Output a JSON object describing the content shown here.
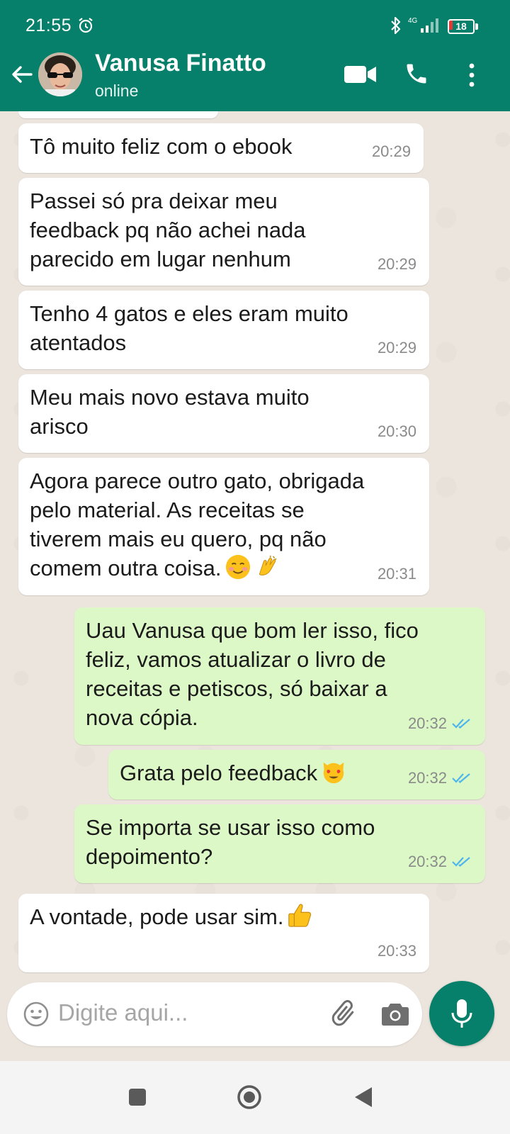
{
  "status_bar": {
    "time": "21:55",
    "network": "4G",
    "battery": "18",
    "icons": [
      "alarm-icon",
      "bluetooth-icon",
      "signal-icon",
      "battery-icon"
    ]
  },
  "header": {
    "contact_name": "Vanusa Finatto",
    "status": "online",
    "icons": [
      "back-arrow-icon",
      "video-call-icon",
      "phone-icon",
      "menu-icon"
    ]
  },
  "messages": [
    {
      "direction": "in",
      "text": "Tô muito feliz com o ebook",
      "time": "20:29"
    },
    {
      "direction": "in",
      "text": "Passei só pra deixar meu\nfeedback pq não achei nada\nparecido em lugar nenhum",
      "time": "20:29"
    },
    {
      "direction": "in",
      "text": "Tenho 4 gatos e eles eram muito\natentados",
      "time": "20:29"
    },
    {
      "direction": "in",
      "text": "Meu mais novo estava muito\narisco",
      "time": "20:30"
    },
    {
      "direction": "in",
      "text": "Agora parece outro gato, obrigada\npelo material. As receitas se\ntiverem mais eu quero, pq não\ncomem outra coisa.",
      "time": "20:31",
      "emojis": [
        "smiling-blush-emoji",
        "clapping-hands-emoji"
      ]
    },
    {
      "direction": "out",
      "text": "Uau Vanusa que bom ler isso, fico\nfeliz, vamos atualizar o livro de\nreceitas e petiscos, só baixar a\nnova cópia.",
      "time": "20:32",
      "read": true
    },
    {
      "direction": "out",
      "text": "Grata pelo feedback",
      "time": "20:32",
      "read": true,
      "emojis": [
        "heart-eyes-cat-emoji"
      ]
    },
    {
      "direction": "out",
      "text": "Se importa se usar isso como\ndepoimento?",
      "time": "20:32",
      "read": true
    },
    {
      "direction": "in",
      "text": "A vontade, pode usar sim.",
      "time": "20:33",
      "emojis": [
        "thumbs-up-emoji"
      ]
    }
  ],
  "composer": {
    "placeholder": "Digite aqui...",
    "icons": [
      "emoji-icon",
      "attach-clip-icon",
      "camera-icon",
      "microphone-icon"
    ]
  },
  "colors": {
    "header": "#06806a",
    "incoming_bubble": "#ffffff",
    "outgoing_bubble": "#dcf8c6",
    "read_ticks": "#4fb6ec",
    "chat_background": "#ece5dd"
  },
  "navigation": {
    "icons": [
      "recents-square-icon",
      "home-circle-icon",
      "back-triangle-icon"
    ]
  }
}
